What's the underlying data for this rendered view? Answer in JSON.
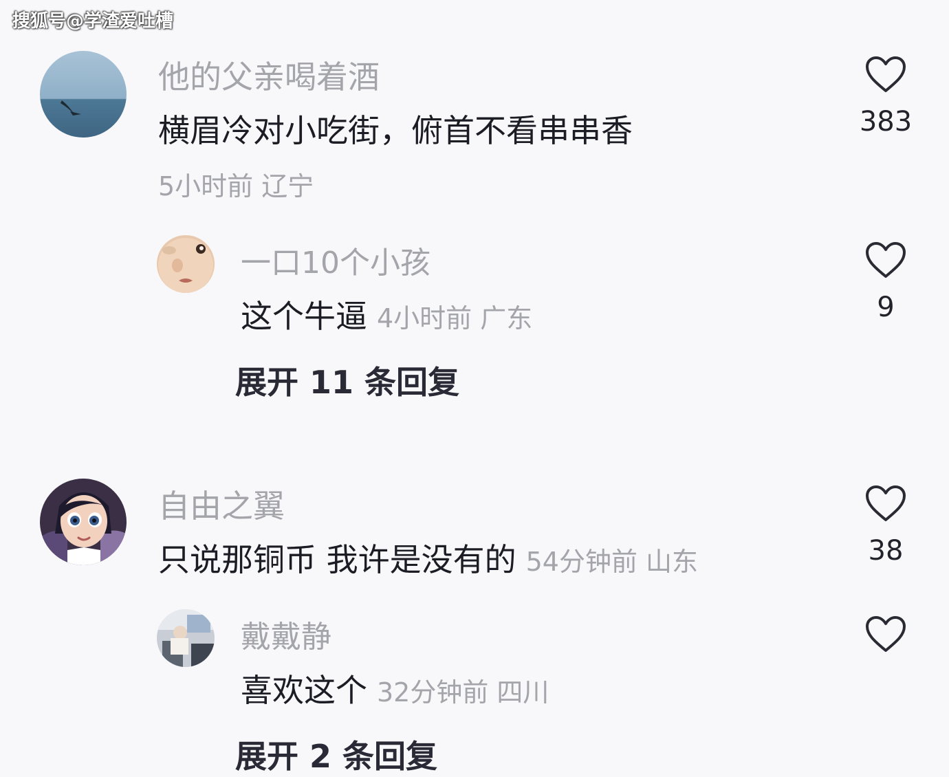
{
  "watermark": "搜狐号@学渣爱吐槽",
  "comments": [
    {
      "username": "他的父亲喝着酒",
      "text": "横眉冷对小吃街，俯首不看串串香",
      "meta": "5小时前 辽宁",
      "likes": "383",
      "avatar": "sea-bird-avatar",
      "replies": [
        {
          "username": "一口10个小孩",
          "text": "这个牛逼",
          "meta": "4小时前 广东",
          "likes": "9",
          "avatar": "baby-face-avatar"
        }
      ],
      "expand_label": "展开 11 条回复"
    },
    {
      "username": "自由之翼",
      "text": "只说那铜币 我许是没有的",
      "meta": "54分钟前 山东",
      "likes": "38",
      "avatar": "cartoon-girl-avatar",
      "replies": [
        {
          "username": "戴戴静",
          "text": "喜欢这个",
          "meta": "32分钟前 四川",
          "likes": "",
          "avatar": "photo-avatar"
        }
      ],
      "expand_label": "展开 2 条回复"
    }
  ],
  "colors": {
    "background": "#f8f8fa",
    "username": "#a4a4ab",
    "text": "#1c1c24",
    "icon": "#2a2a33"
  },
  "icons": {
    "like": "heart-outline-icon"
  }
}
